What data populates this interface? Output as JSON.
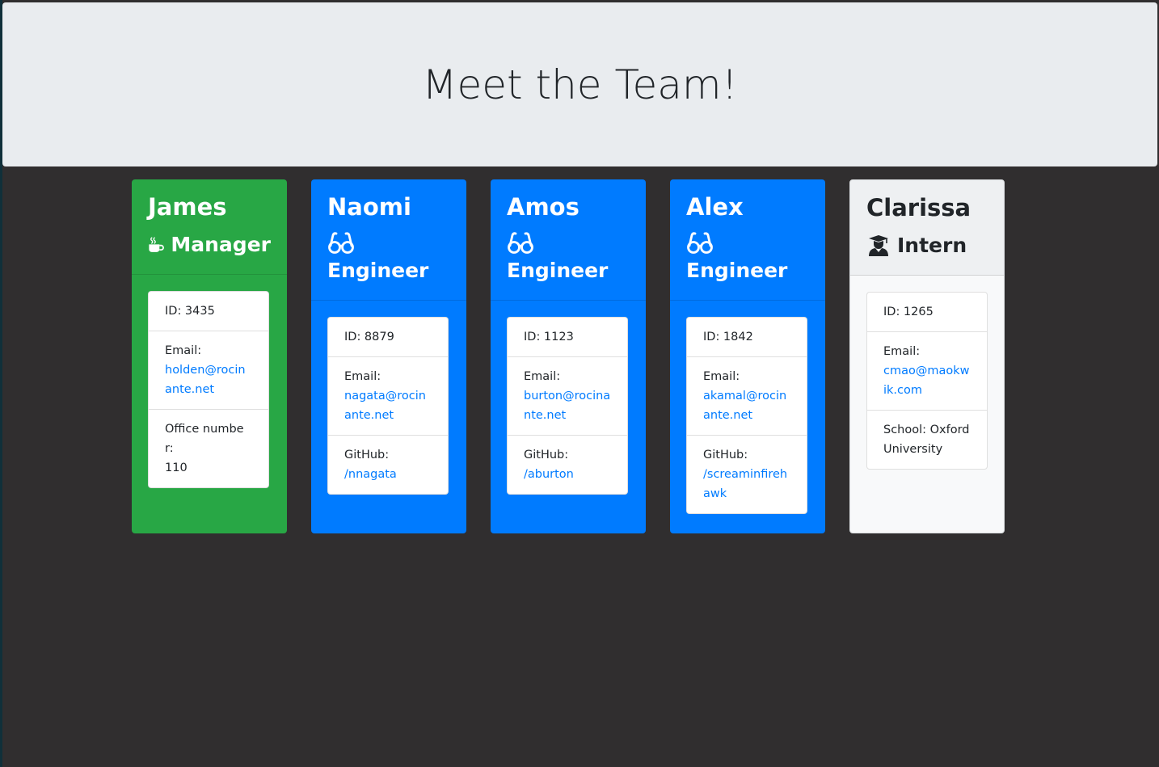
{
  "header": {
    "title": "Meet the Team!"
  },
  "colors": {
    "manager": "#28a745",
    "engineer": "#007bff",
    "intern": "#f8f9fa",
    "link": "#007bff",
    "page_background": "#302e2f",
    "jumbotron": "#e9ecef"
  },
  "cards": [
    {
      "name": "James",
      "role": "Manager",
      "role_icon": "mug-hot-icon",
      "id_text": "ID: 3435",
      "email_label": "Email:",
      "email": "holden@rocinante.net",
      "extra_label": "Office number:",
      "extra_value": "110"
    },
    {
      "name": "Naomi",
      "role": "Engineer",
      "role_icon": "glasses-icon",
      "id_text": "ID: 8879",
      "email_label": "Email:",
      "email": "nagata@rocinante.net",
      "extra_label": "GitHub:",
      "extra_value": "/nnagata"
    },
    {
      "name": "Amos",
      "role": "Engineer",
      "role_icon": "glasses-icon",
      "id_text": "ID: 1123",
      "email_label": "Email:",
      "email": "burton@rocinante.net",
      "extra_label": "GitHub:",
      "extra_value": "/aburton"
    },
    {
      "name": "Alex",
      "role": "Engineer",
      "role_icon": "glasses-icon",
      "id_text": "ID: 1842",
      "email_label": "Email:",
      "email": "akamal@rocinante.net",
      "extra_label": "GitHub:",
      "extra_value": "/screaminfirehawk"
    },
    {
      "name": "Clarissa",
      "role": "Intern",
      "role_icon": "user-graduate-icon",
      "id_text": "ID: 1265",
      "email_label": "Email:",
      "email": "cmao@maokwik.com",
      "extra_label": "School: Oxford University",
      "extra_value": ""
    }
  ]
}
